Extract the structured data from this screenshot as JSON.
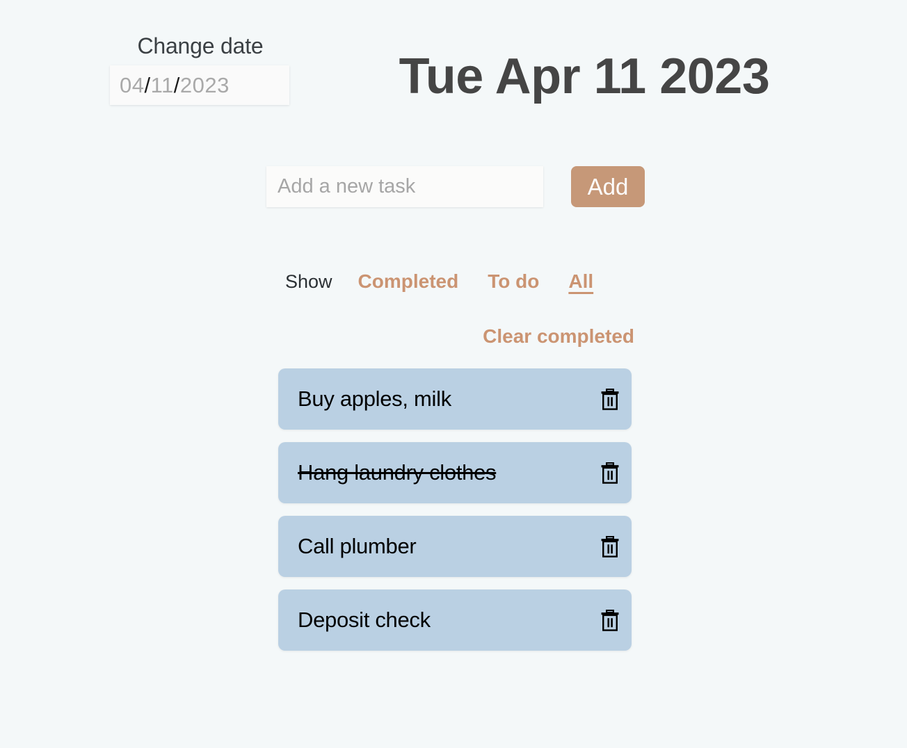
{
  "header": {
    "change_date_label": "Change date",
    "date_input": {
      "month": "04",
      "day": "11",
      "year": "2023",
      "separator": "/"
    },
    "title": "Tue Apr 11 2023"
  },
  "add_task": {
    "placeholder": "Add a new task",
    "value": "",
    "button_label": "Add"
  },
  "filters": {
    "show_label": "Show",
    "options": [
      {
        "label": "Completed",
        "active": false
      },
      {
        "label": "To do",
        "active": false
      },
      {
        "label": "All",
        "active": true
      }
    ],
    "clear_completed_label": "Clear completed"
  },
  "tasks": [
    {
      "label": "Buy apples, milk",
      "completed": false,
      "delete_icon": "trash-icon"
    },
    {
      "label": "Hang laundry clothes",
      "completed": true,
      "delete_icon": "trash-icon"
    },
    {
      "label": "Call plumber",
      "completed": false,
      "delete_icon": "trash-icon"
    },
    {
      "label": "Deposit check",
      "completed": false,
      "delete_icon": "trash-icon"
    }
  ],
  "colors": {
    "page_background": "#f4f8f9",
    "accent": "#c69878",
    "filter_link": "#cb9472",
    "task_card": "#bad0e3",
    "title_text": "#454545",
    "task_text": "#000000",
    "placeholder_text": "#a6a6a6"
  }
}
